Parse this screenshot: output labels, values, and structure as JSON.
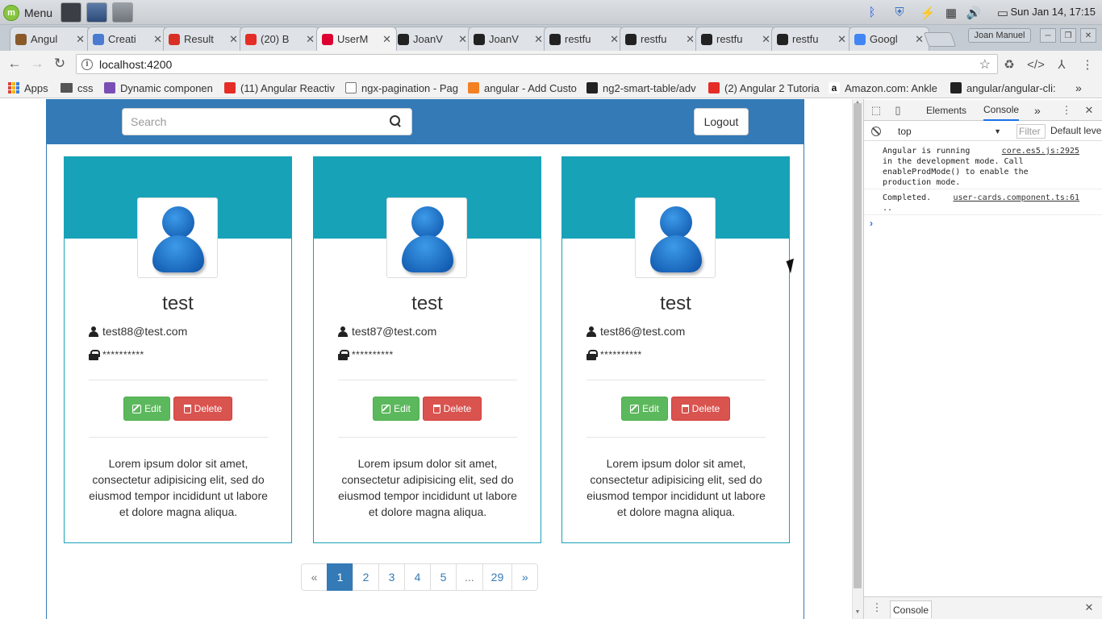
{
  "taskbar": {
    "menu_label": "Menu",
    "clock": "Sun Jan 14, 17:15"
  },
  "tabs": [
    {
      "label": "Angul",
      "color": "#8a5a2b"
    },
    {
      "label": "Creati",
      "color": "#4a7bd0"
    },
    {
      "label": "Result",
      "color": "#d93025"
    },
    {
      "label": "(20) B",
      "color": "#e52d27"
    },
    {
      "label": "UserM",
      "color": "#dd0031"
    },
    {
      "label": "JoanV",
      "color": "#222222"
    },
    {
      "label": "JoanV",
      "color": "#222222"
    },
    {
      "label": "restfu",
      "color": "#222222"
    },
    {
      "label": "restfu",
      "color": "#222222"
    },
    {
      "label": "restfu",
      "color": "#222222"
    },
    {
      "label": "restfu",
      "color": "#222222"
    },
    {
      "label": "Googl",
      "color": "#4285f4"
    }
  ],
  "profile_name": "Joan Manuel",
  "address_bar": {
    "url": "localhost:4200"
  },
  "bookmarks": [
    {
      "label": "Apps",
      "icon": "apps-grid-icon"
    },
    {
      "label": "css",
      "icon": "folder-icon"
    },
    {
      "label": "Dynamic componen",
      "icon": "shield-icon"
    },
    {
      "label": "(11) Angular Reactiv",
      "icon": "youtube-icon"
    },
    {
      "label": "ngx-pagination - Pag",
      "icon": "document-icon"
    },
    {
      "label": "angular - Add Custo",
      "icon": "stackoverflow-icon"
    },
    {
      "label": "ng2-smart-table/adv",
      "icon": "github-icon"
    },
    {
      "label": "(2) Angular 2 Tutoria",
      "icon": "youtube-icon"
    },
    {
      "label": "Amazon.com: Ankle",
      "icon": "amazon-icon"
    },
    {
      "label": "angular/angular-cli:",
      "icon": "github-icon"
    }
  ],
  "app": {
    "search_placeholder": "Search",
    "logout_label": "Logout",
    "edit_label": "Edit",
    "delete_label": "Delete",
    "cards": [
      {
        "name": "test",
        "email": "test88@test.com",
        "password": "**********",
        "description": "Lorem ipsum dolor sit amet, consectetur adipisicing elit, sed do eiusmod tempor incididunt ut labore et dolore magna aliqua."
      },
      {
        "name": "test",
        "email": "test87@test.com",
        "password": "**********",
        "description": "Lorem ipsum dolor sit amet, consectetur adipisicing elit, sed do eiusmod tempor incididunt ut labore et dolore magna aliqua."
      },
      {
        "name": "test",
        "email": "test86@test.com",
        "password": "**********",
        "description": "Lorem ipsum dolor sit amet, consectetur adipisicing elit, sed do eiusmod tempor incididunt ut labore et dolore magna aliqua."
      }
    ],
    "pagination": {
      "prev": "«",
      "pages": [
        "1",
        "2",
        "3",
        "4",
        "5",
        "...",
        "29"
      ],
      "next": "»",
      "active": "1"
    }
  },
  "devtools": {
    "tabs": [
      "Elements",
      "Console"
    ],
    "more": "»",
    "context": "top",
    "filter_placeholder": "Filter",
    "levels": "Default levels",
    "messages": [
      {
        "text": "Angular is running\nin the development mode. Call\nenableProdMode() to enable the\nproduction mode.",
        "source": "core.es5.js:2925"
      },
      {
        "text": "Completed.\n..",
        "source": "user-cards.component.ts:61"
      }
    ],
    "prompt": "›",
    "drawer_tab": "Console"
  },
  "colors": {
    "primary": "#337ab7",
    "card_header": "#17a2b8",
    "success": "#5cb85c",
    "danger": "#d9534f"
  }
}
